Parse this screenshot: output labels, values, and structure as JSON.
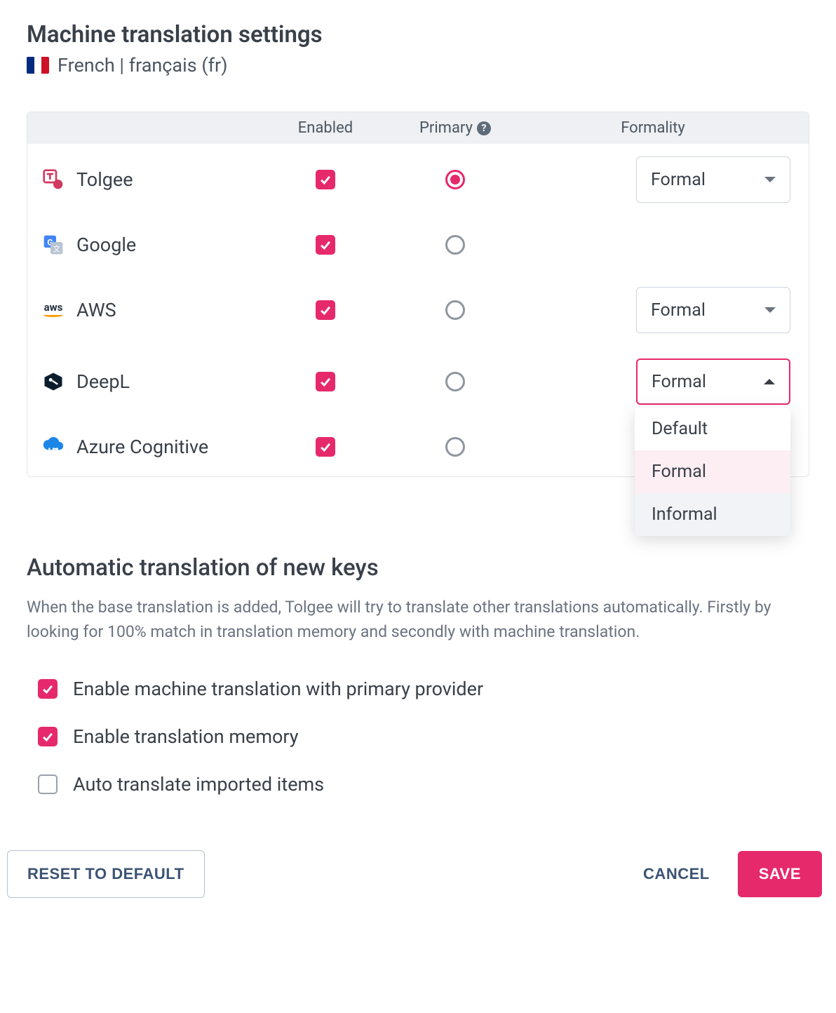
{
  "header": {
    "title": "Machine translation settings",
    "language_label": "French | français (fr)",
    "flag_colors": [
      "#002b7f",
      "#ffffff",
      "#ce1126"
    ]
  },
  "table": {
    "columns": {
      "enabled": "Enabled",
      "primary": "Primary",
      "formality": "Formality"
    },
    "providers": [
      {
        "name": "Tolgee",
        "icon": "tolgee",
        "enabled": true,
        "primary": true,
        "formality": "Formal",
        "formality_supported": true,
        "dropdown_open": false
      },
      {
        "name": "Google",
        "icon": "google",
        "enabled": true,
        "primary": false,
        "formality": null,
        "formality_supported": false,
        "dropdown_open": false
      },
      {
        "name": "AWS",
        "icon": "aws",
        "enabled": true,
        "primary": false,
        "formality": "Formal",
        "formality_supported": true,
        "dropdown_open": false
      },
      {
        "name": "DeepL",
        "icon": "deepl",
        "enabled": true,
        "primary": false,
        "formality": "Formal",
        "formality_supported": true,
        "dropdown_open": true
      },
      {
        "name": "Azure Cognitive",
        "icon": "azure",
        "enabled": true,
        "primary": false,
        "formality": null,
        "formality_supported": false,
        "dropdown_open": false
      }
    ],
    "formality_options": [
      {
        "label": "Default",
        "state": ""
      },
      {
        "label": "Formal",
        "state": "selected"
      },
      {
        "label": "Informal",
        "state": "hover"
      }
    ]
  },
  "auto_section": {
    "title": "Automatic translation of new keys",
    "description": "When the base translation is added, Tolgee will try to translate other translations automatically. Firstly by looking for 100% match in translation memory and secondly with machine translation.",
    "options": [
      {
        "label": "Enable machine translation with primary provider",
        "checked": true
      },
      {
        "label": "Enable translation memory",
        "checked": true
      },
      {
        "label": "Auto translate imported items",
        "checked": false
      }
    ]
  },
  "footer": {
    "reset": "RESET TO DEFAULT",
    "cancel": "CANCEL",
    "save": "SAVE"
  }
}
